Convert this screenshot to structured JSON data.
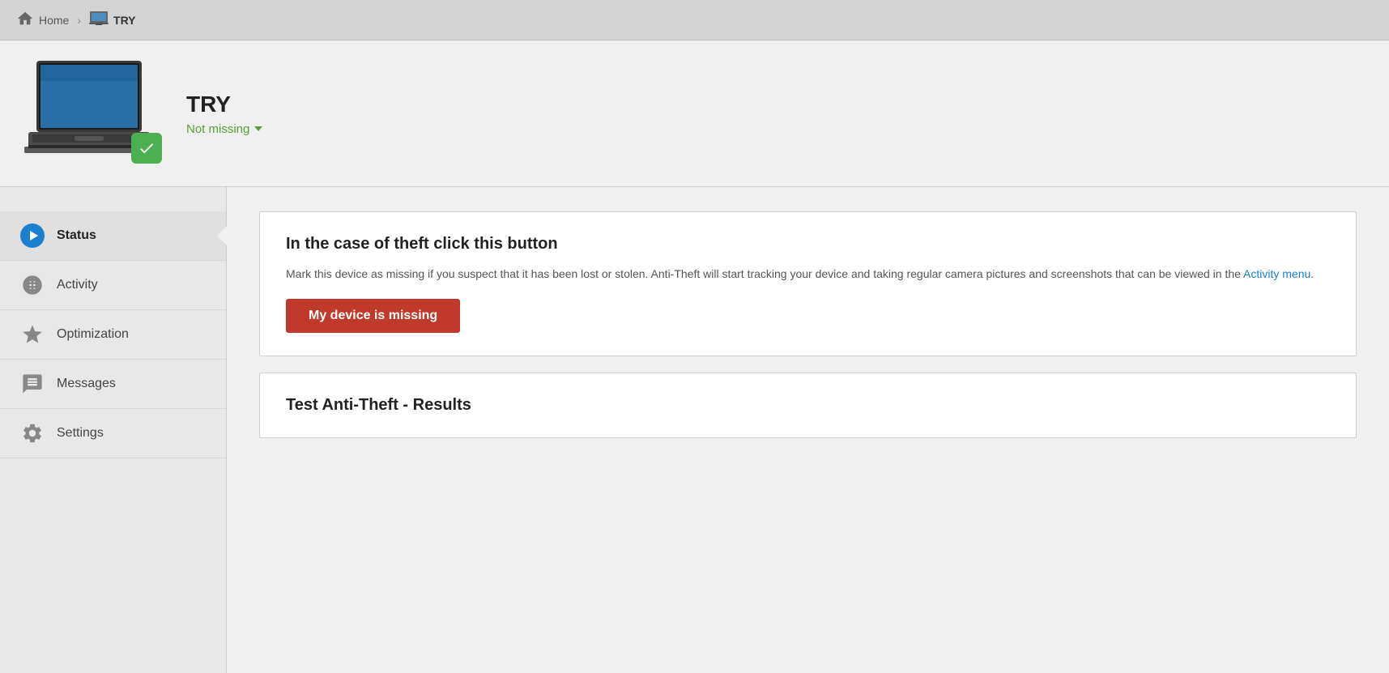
{
  "nav": {
    "home_label": "Home",
    "current_label": "TRY"
  },
  "device": {
    "name": "TRY",
    "status": "Not missing",
    "status_color": "#5a9e3a",
    "badge_color": "#4caf50"
  },
  "sidebar": {
    "items": [
      {
        "id": "status",
        "label": "Status",
        "icon_type": "play",
        "active": true
      },
      {
        "id": "activity",
        "label": "Activity",
        "icon_type": "camera",
        "active": false
      },
      {
        "id": "optimization",
        "label": "Optimization",
        "icon_type": "star",
        "active": false
      },
      {
        "id": "messages",
        "label": "Messages",
        "icon_type": "message",
        "active": false
      },
      {
        "id": "settings",
        "label": "Settings",
        "icon_type": "settings",
        "active": false
      }
    ]
  },
  "theft_card": {
    "title": "In the case of theft click this button",
    "description": "Mark this device as missing if you suspect that it has been lost or stolen. Anti-Theft will start tracking your device and taking regular camera pictures and screenshots that can be viewed in the",
    "link_text": "Activity menu.",
    "button_label": "My device is missing"
  },
  "results_card": {
    "title": "Test Anti-Theft - Results"
  }
}
